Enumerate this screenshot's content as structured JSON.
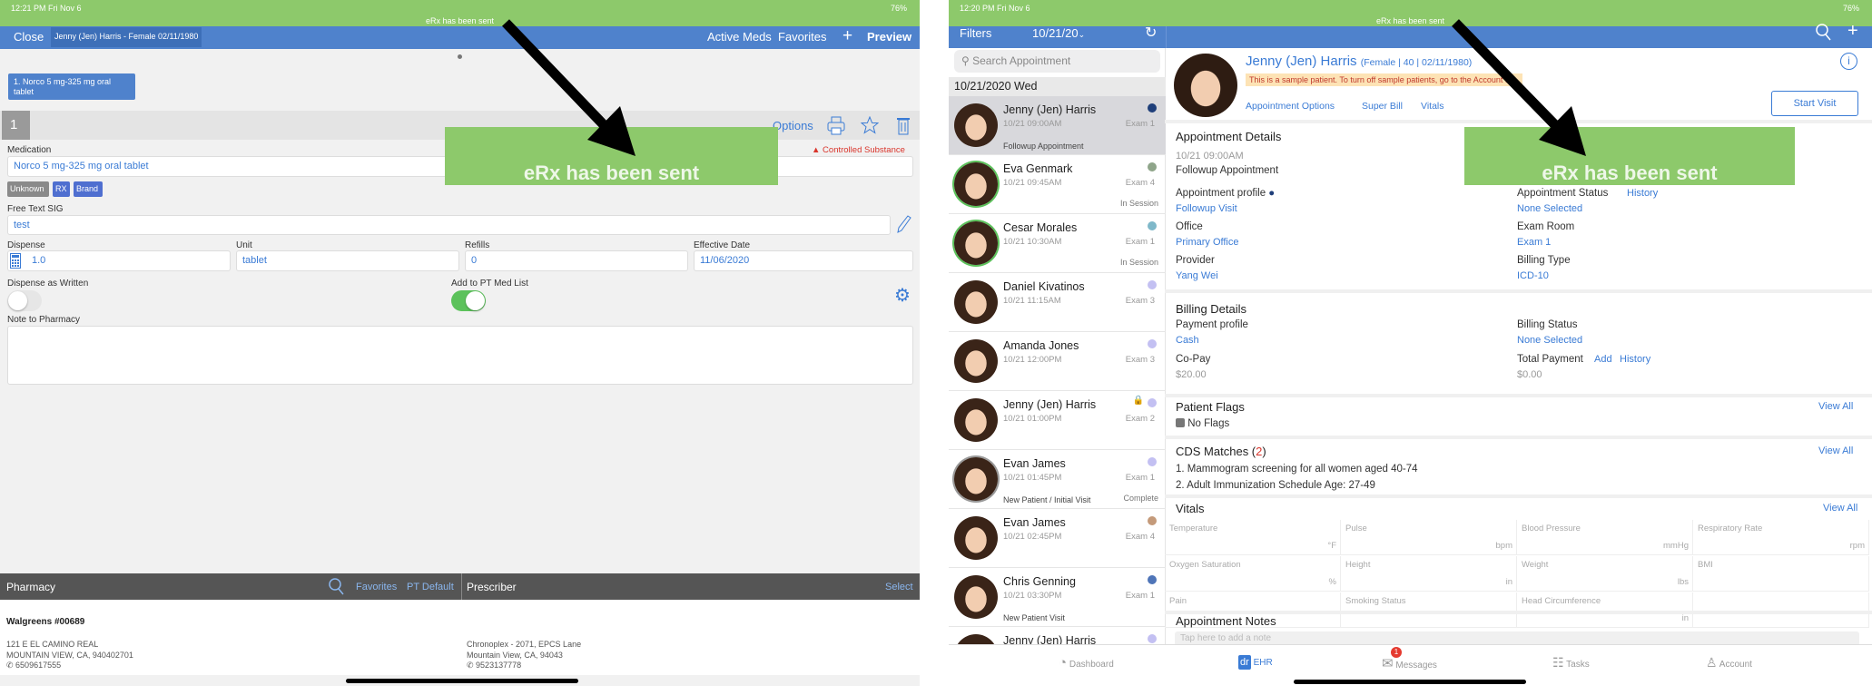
{
  "left": {
    "status": {
      "time": "12:21 PM  Fri Nov 6",
      "battery": "76%",
      "message": "eRx has been sent"
    },
    "nav": {
      "close": "Close",
      "patient": "Jenny (Jen) Harris - Female 02/11/1980",
      "active_meds": "Active Meds",
      "favorites": "Favorites",
      "add": "+",
      "preview": "Preview"
    },
    "med_chip": "1. Norco 5 mg-325 mg oral tablet",
    "row_number": "1",
    "options": "Options",
    "medication_label": "Medication",
    "controlled": "Controlled Substance",
    "medication_value": "Norco 5 mg-325 mg oral tablet",
    "tags": [
      "Unknown",
      "RX",
      "Brand"
    ],
    "sig_label": "Free Text SIG",
    "sig_value": "test",
    "dispense_label": "Dispense",
    "dispense_value": "1.0",
    "unit_label": "Unit",
    "unit_value": "tablet",
    "refills_label": "Refills",
    "refills_value": "0",
    "date_label": "Effective Date",
    "date_value": "11/06/2020",
    "daw_label": "Dispense as Written",
    "daw_on": false,
    "medlist_label": "Add to PT Med List",
    "medlist_on": true,
    "note_label": "Note to Pharmacy",
    "pharmacy": {
      "title": "Pharmacy",
      "favorites": "Favorites",
      "default": "PT Default",
      "name": "Walgreens #00689",
      "addr1": "121 E EL CAMINO REAL",
      "addr2": "MOUNTAIN VIEW, CA, 940402701",
      "phone": "6509617555"
    },
    "prescriber": {
      "title": "Prescriber",
      "select": "Select",
      "addr1": "Chronoplex - 2071, EPCS Lane",
      "addr2": "Mountain View, CA, 94043",
      "phone": "9523137778"
    },
    "overlay": "eRx has been sent"
  },
  "right": {
    "status": {
      "time": "12:20 PM  Fri Nov 6",
      "battery": "76%",
      "message": "eRx has been sent"
    },
    "nav": {
      "filters": "Filters",
      "date": "10/21/20"
    },
    "search_placeholder": "Search Appointment",
    "date_header": "10/21/2020 Wed",
    "appointments": [
      {
        "name": "Jenny (Jen) Harris",
        "time": "10/21 09:00AM",
        "room": "Exam 1",
        "type": "Followup Appointment",
        "status": "",
        "dot": "#1f3f7a",
        "selected": true
      },
      {
        "name": "Eva Genmark",
        "time": "10/21 09:45AM",
        "room": "Exam 4",
        "type": "",
        "status": "In Session",
        "dot": "#8fa58a"
      },
      {
        "name": "Cesar Morales",
        "time": "10/21 10:30AM",
        "room": "Exam 1",
        "type": "",
        "status": "In Session",
        "dot": "#7fb8c9"
      },
      {
        "name": "Daniel Kivatinos",
        "time": "10/21 11:15AM",
        "room": "Exam 3",
        "type": "",
        "status": "",
        "dot": "#c3c0f2"
      },
      {
        "name": "Amanda Jones",
        "time": "10/21 12:00PM",
        "room": "Exam 3",
        "type": "",
        "status": "",
        "dot": "#c3c0f2"
      },
      {
        "name": "Jenny (Jen) Harris",
        "time": "10/21 01:00PM",
        "room": "Exam 2",
        "type": "",
        "status": "",
        "dot": "#c3c0f2",
        "locked": true
      },
      {
        "name": "Evan James",
        "time": "10/21 01:45PM",
        "room": "Exam 1",
        "type": "New Patient / Initial Visit",
        "status": "Complete",
        "dot": "#c3c0f2"
      },
      {
        "name": "Evan James",
        "time": "10/21 02:45PM",
        "room": "Exam 4",
        "type": "",
        "status": "",
        "dot": "#c49a7a"
      },
      {
        "name": "Chris Genning",
        "time": "10/21 03:30PM",
        "room": "Exam 1",
        "type": "New Patient Visit",
        "status": "",
        "dot": "#4f75b8"
      },
      {
        "name": "Jenny (Jen) Harris",
        "time": "",
        "room": "",
        "type": "",
        "status": "",
        "dot": "#c3c0f2"
      }
    ],
    "patient": {
      "name": "Jenny (Jen) Harris",
      "info": "(Female | 40 | 02/11/1980)",
      "banner": "This is a sample patient. To turn off sample patients, go to the Account tab.",
      "links": [
        "Appointment Options",
        "Super Bill",
        "Vitals"
      ],
      "start_visit": "Start Visit"
    },
    "appointment": {
      "title": "Appointment Details",
      "time": "10/21 09:00AM",
      "type": "Followup Appointment",
      "profile_label": "Appointment profile",
      "profile": "Followup Visit",
      "status_label": "Appointment Status",
      "history": "History",
      "status": "None Selected",
      "office_label": "Office",
      "office": "Primary Office",
      "room_label": "Exam Room",
      "room": "Exam 1",
      "provider_label": "Provider",
      "provider": "Yang Wei",
      "billing_type_label": "Billing Type",
      "billing_type": "ICD-10"
    },
    "billing": {
      "title": "Billing Details",
      "payment_label": "Payment profile",
      "payment": "Cash",
      "status_label": "Billing Status",
      "status": "None Selected",
      "copay_label": "Co-Pay",
      "copay": "$20.00",
      "total_label": "Total Payment",
      "add": "Add",
      "history": "History",
      "total": "$0.00"
    },
    "flags": {
      "title": "Patient Flags",
      "view_all": "View All",
      "value": "No Flags"
    },
    "cds": {
      "title": "CDS Matches (",
      "count": "2",
      "close": ")",
      "view_all": "View All",
      "items": [
        "1. Mammogram screening for all women aged 40-74",
        "2. Adult Immunization Schedule Age: 27-49"
      ]
    },
    "vitals": {
      "title": "Vitals",
      "view_all": "View All",
      "cells": [
        {
          "name": "Temperature",
          "unit": "°F"
        },
        {
          "name": "Pulse",
          "unit": "bpm"
        },
        {
          "name": "Blood Pressure",
          "unit": "mmHg"
        },
        {
          "name": "Respiratory Rate",
          "unit": "rpm"
        },
        {
          "name": "Oxygen Saturation",
          "unit": "%"
        },
        {
          "name": "Height",
          "unit": "in"
        },
        {
          "name": "Weight",
          "unit": "lbs"
        },
        {
          "name": "BMI",
          "unit": ""
        },
        {
          "name": "Pain",
          "unit": ""
        },
        {
          "name": "Smoking Status",
          "unit": ""
        },
        {
          "name": "Head Circumference",
          "unit": "in"
        },
        {
          "name": "",
          "unit": ""
        }
      ]
    },
    "notes": {
      "title": "Appointment Notes",
      "placeholder": "Tap here to add a note"
    },
    "tabs": [
      {
        "label": "Dashboard",
        "active": false
      },
      {
        "label": "EHR",
        "active": true
      },
      {
        "label": "Messages",
        "active": false,
        "badge": "1"
      },
      {
        "label": "Tasks",
        "active": false
      },
      {
        "label": "Account",
        "active": false
      }
    ],
    "ehr_logo": "dr",
    "overlay": "eRx has been sent"
  },
  "colors": {
    "green": "#8dc96b",
    "blue": "#4f82cc",
    "link": "#3a7bd5",
    "red": "#d9342b"
  }
}
